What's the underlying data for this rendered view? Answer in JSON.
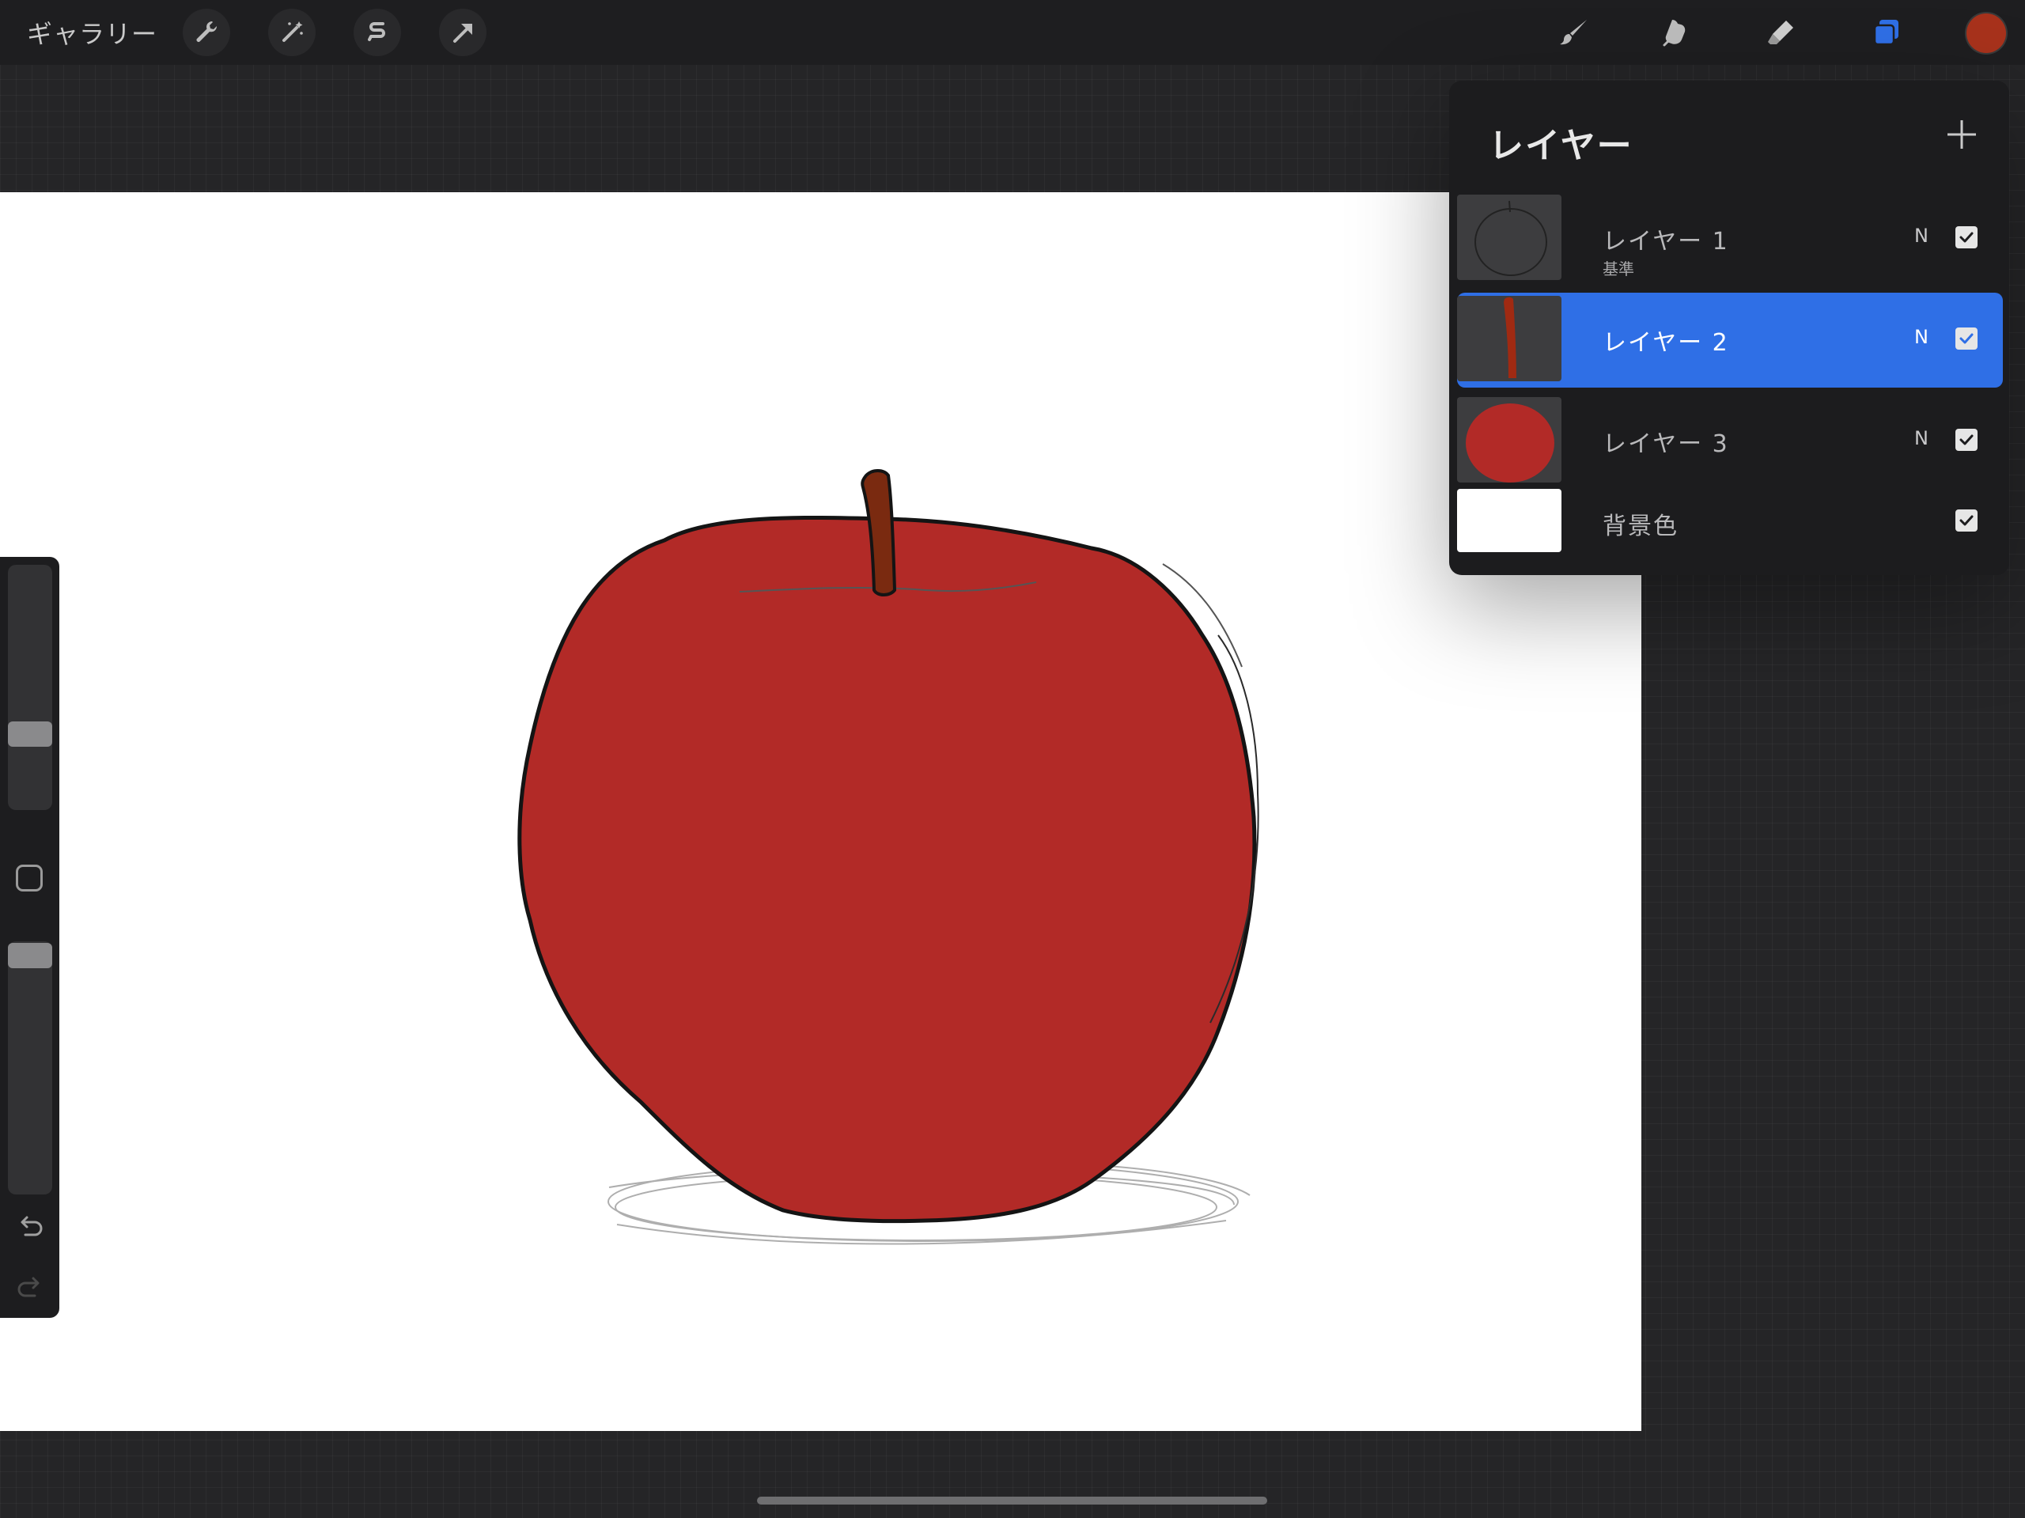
{
  "topbar": {
    "gallery_label": "ギャラリー",
    "left_tools": [
      "wrench-icon",
      "magic-wand-icon",
      "selection-icon",
      "transform-arrow-icon"
    ],
    "right_tools": [
      "brush-icon",
      "smudge-icon",
      "eraser-icon",
      "layers-icon"
    ],
    "active_tool": "layers-icon",
    "current_color": "#a8321c"
  },
  "layers": {
    "title": "レイヤー",
    "items": [
      {
        "name": "レイヤー 1",
        "subtitle": "基準",
        "blend": "N",
        "visible": true,
        "selected": false
      },
      {
        "name": "レイヤー 2",
        "subtitle": "",
        "blend": "N",
        "visible": true,
        "selected": true
      },
      {
        "name": "レイヤー 3",
        "subtitle": "",
        "blend": "N",
        "visible": true,
        "selected": false
      },
      {
        "name": "背景色",
        "subtitle": "",
        "blend": "",
        "visible": true,
        "selected": false
      }
    ]
  },
  "sidebar": {
    "brush_size_level": 0.38,
    "opacity_level": 0.96
  },
  "colors": {
    "accent": "#2f6fe6",
    "apple_red": "#b22a27",
    "stem": "#7a2a10"
  }
}
